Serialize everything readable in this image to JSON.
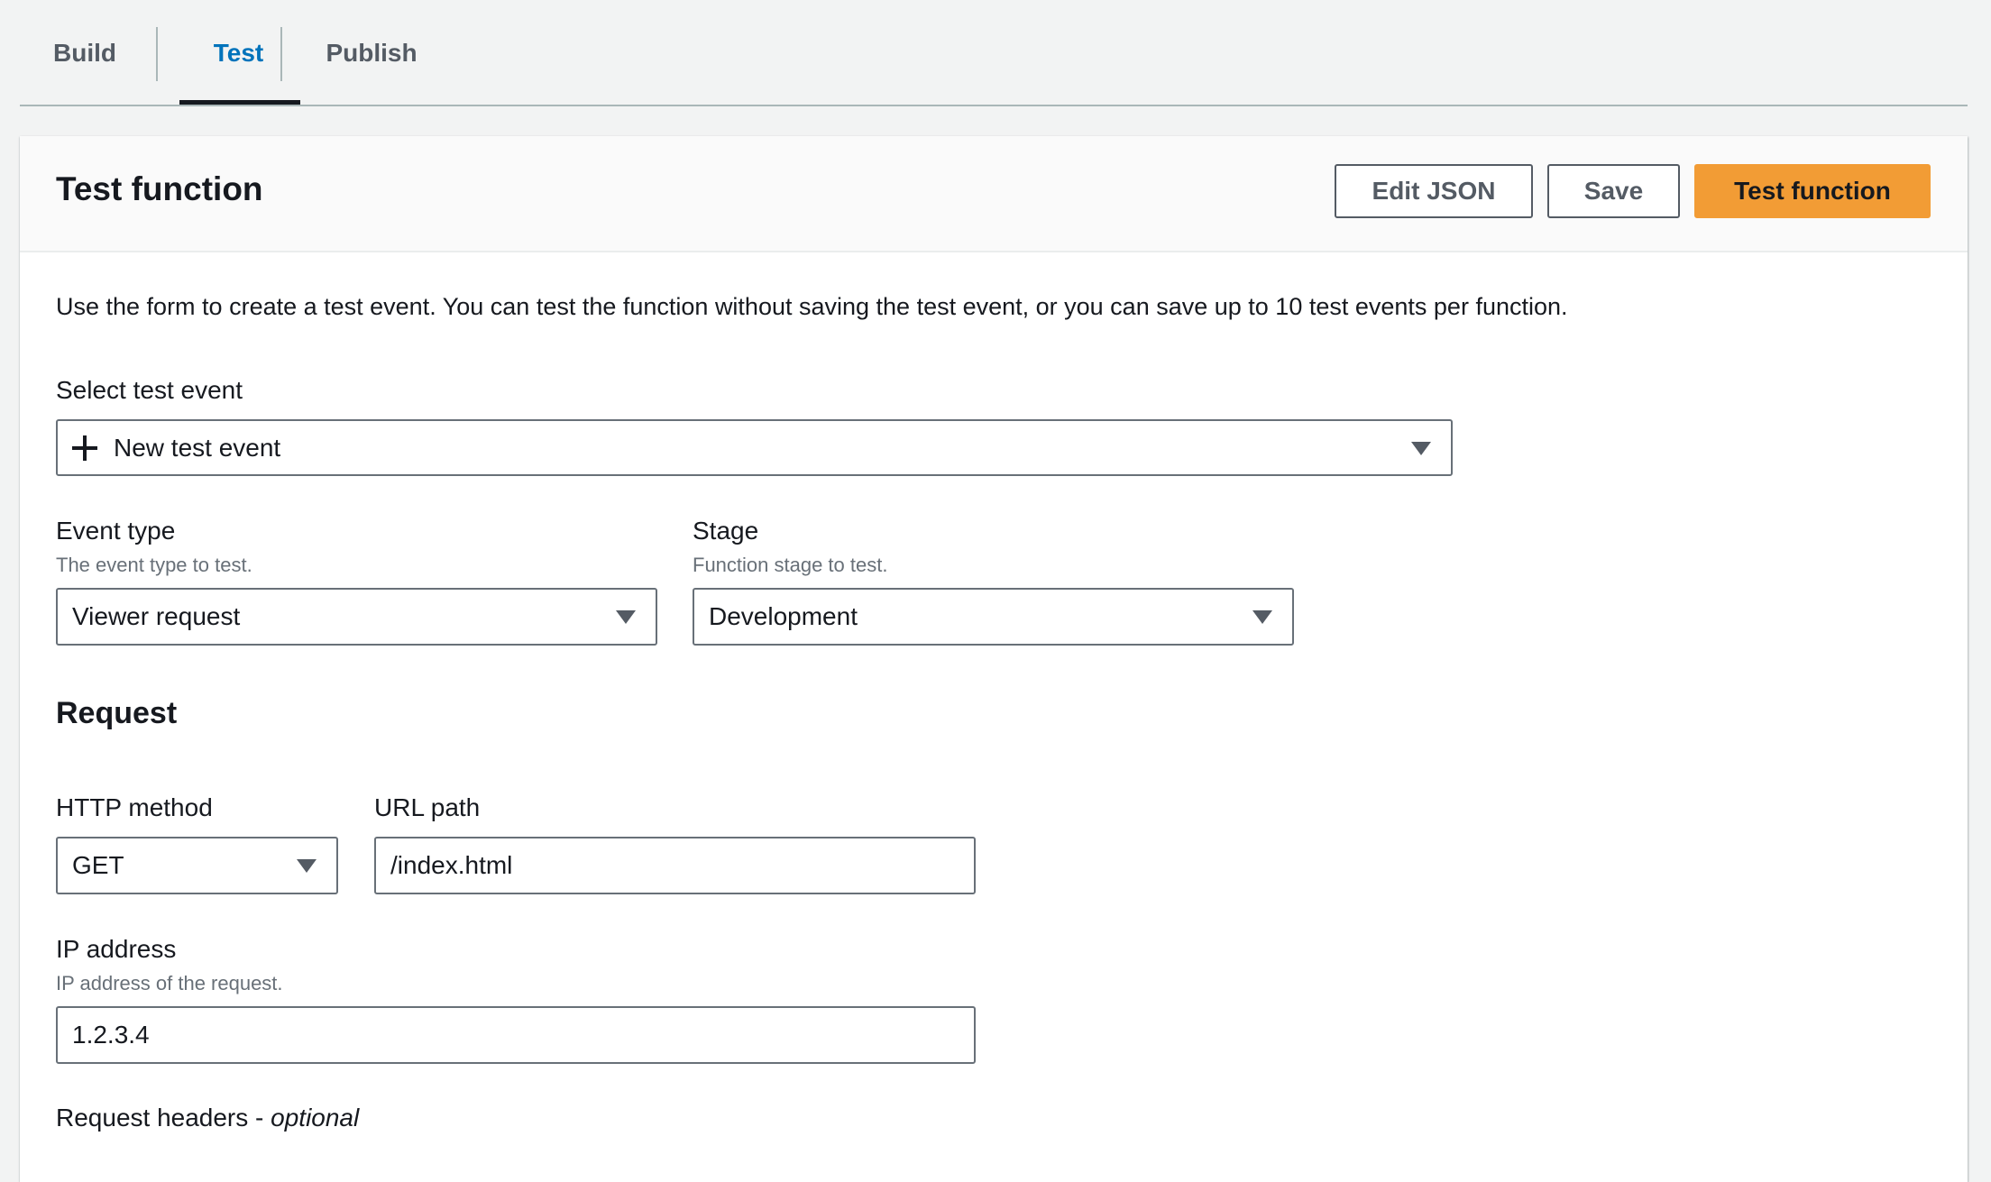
{
  "tabs": [
    {
      "label": "Build",
      "active": false
    },
    {
      "label": "Test",
      "active": true
    },
    {
      "label": "Publish",
      "active": false
    }
  ],
  "card": {
    "title": "Test function",
    "buttons": {
      "edit_json": "Edit JSON",
      "save": "Save",
      "test_function": "Test function"
    },
    "intro": "Use the form to create a test event. You can test the function without saving the test event, or you can save up to 10 test events per function."
  },
  "form": {
    "select_test_event": {
      "label": "Select test event",
      "value": "New test event",
      "icon": "plus-icon"
    },
    "event_type": {
      "label": "Event type",
      "description": "The event type to test.",
      "value": "Viewer request"
    },
    "stage": {
      "label": "Stage",
      "description": "Function stage to test.",
      "value": "Development"
    },
    "request": {
      "heading": "Request",
      "http_method": {
        "label": "HTTP method",
        "value": "GET"
      },
      "url_path": {
        "label": "URL path",
        "value": "/index.html"
      },
      "ip_address": {
        "label": "IP address",
        "description": "IP address of the request.",
        "value": "1.2.3.4"
      },
      "request_headers": {
        "label": "Request headers - ",
        "optional": "optional"
      }
    }
  },
  "colors": {
    "primary_button": "#f29c35",
    "active_tab": "#0073bb",
    "background": "#f2f3f3"
  }
}
